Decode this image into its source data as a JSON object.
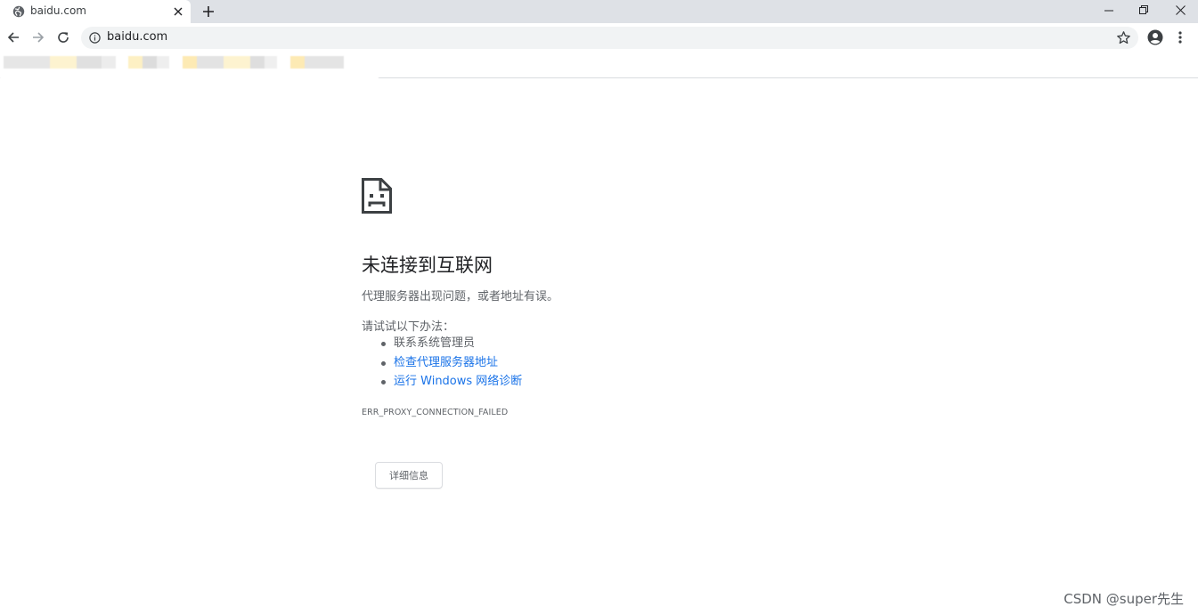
{
  "tab": {
    "title": "baidu.com",
    "icon": "globe-icon",
    "close_icon": "close-icon"
  },
  "newtab_icon": "plus-icon",
  "window_controls": [
    "minimize-icon",
    "restore-icon",
    "close-icon"
  ],
  "toolbar": {
    "url": "baidu.com",
    "back_icon": "arrow-left-icon",
    "forward_icon": "arrow-right-icon",
    "reload_icon": "reload-icon",
    "info_icon": "info-icon",
    "bookmark_icon": "star-icon",
    "profile_icon": "account-circle-icon",
    "menu_icon": "more-vert-icon"
  },
  "error": {
    "icon": "sad-document-icon",
    "title": "未连接到互联网",
    "description": "代理服务器出现问题，或者地址有误。",
    "suggestions_heading": "请试试以下办法：",
    "suggestions": [
      {
        "text": "联系系统管理员",
        "link": false
      },
      {
        "text": "检查代理服务器地址",
        "link": true
      },
      {
        "text": "运行 Windows 网络诊断",
        "link": true
      }
    ],
    "code": "ERR_PROXY_CONNECTION_FAILED",
    "details_button": "详细信息"
  },
  "watermark": "CSDN @super先生",
  "colors": {
    "link": "#1a73e8",
    "text_secondary": "#5f6368",
    "tabstrip_bg": "#dee1e6",
    "omnibox_bg": "#f1f3f4"
  }
}
